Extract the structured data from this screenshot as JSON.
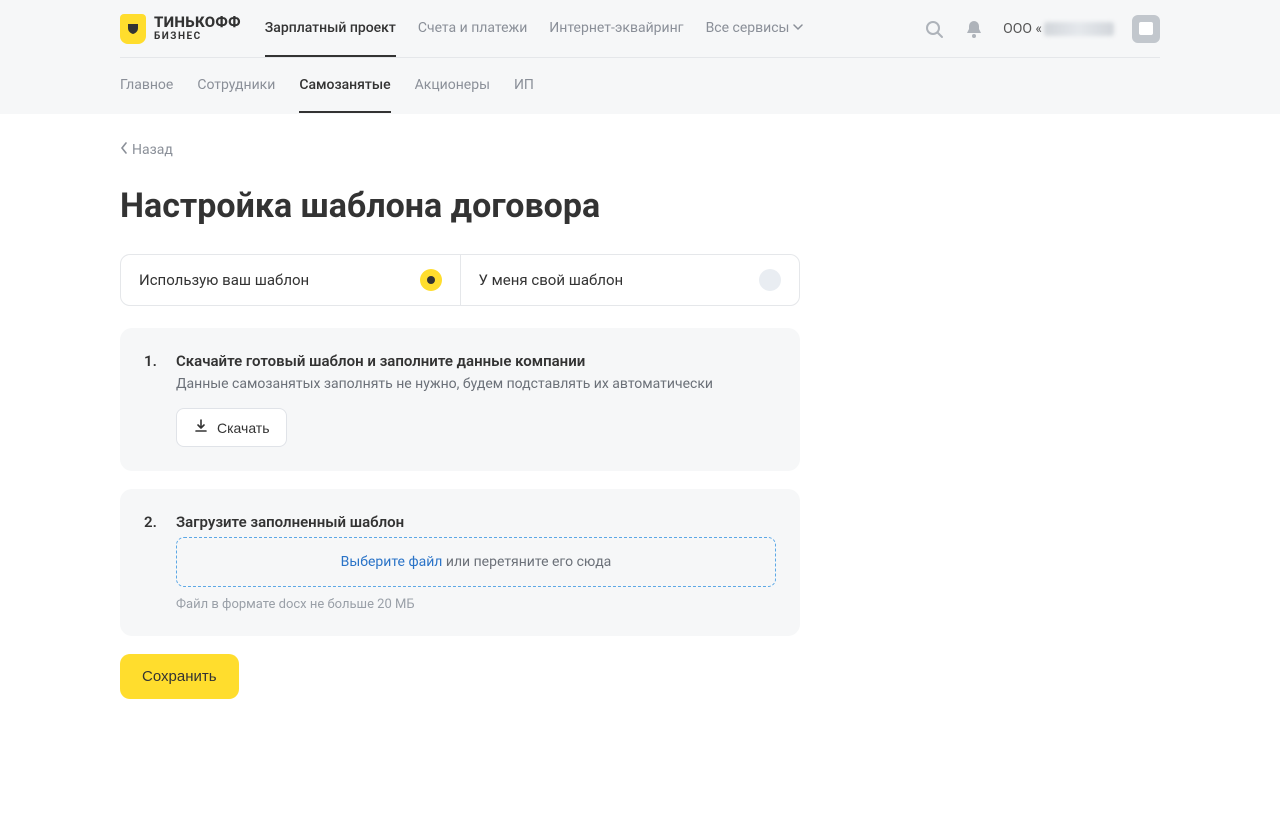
{
  "logo": {
    "line1": "ТИНЬКОФФ",
    "line2": "БИЗНЕС"
  },
  "mainNav": {
    "items": [
      {
        "label": "Зарплатный проект",
        "active": true
      },
      {
        "label": "Счета и платежи"
      },
      {
        "label": "Интернет-эквайринг"
      },
      {
        "label": "Все сервисы",
        "dropdown": true
      }
    ]
  },
  "org": {
    "prefix": "ООО «"
  },
  "subNav": {
    "items": [
      {
        "label": "Главное"
      },
      {
        "label": "Сотрудники"
      },
      {
        "label": "Самозанятые",
        "active": true
      },
      {
        "label": "Акционеры"
      },
      {
        "label": "ИП"
      }
    ]
  },
  "back": "Назад",
  "pageTitle": "Настройка шаблона договора",
  "templateChoice": {
    "options": [
      {
        "label": "Использую ваш шаблон",
        "selected": true
      },
      {
        "label": "У меня свой шаблон",
        "selected": false
      }
    ]
  },
  "step1": {
    "num": "1.",
    "title": "Скачайте готовый шаблон и заполните данные компании",
    "desc": "Данные самозанятых заполнять не нужно, будем подставлять их автоматически",
    "button": "Скачать"
  },
  "step2": {
    "num": "2.",
    "title": "Загрузите заполненный шаблон",
    "dropLink": "Выберите файл",
    "dropRest": " или перетяните его сюда",
    "hint": "Файл в формате docx не больше 20 МБ"
  },
  "save": "Сохранить"
}
